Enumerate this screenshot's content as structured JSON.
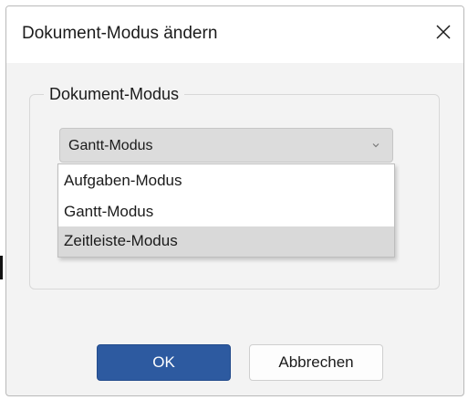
{
  "dialog": {
    "title": "Dokument-Modus ändern",
    "close_icon": "close-icon"
  },
  "group": {
    "legend": "Dokument-Modus",
    "combo": {
      "value": "Gantt-Modus",
      "arrow_icon": "chevron-down-icon"
    },
    "dropdown": {
      "items": [
        {
          "label": "Aufgaben-Modus",
          "highlighted": false
        },
        {
          "label": "Gantt-Modus",
          "highlighted": false
        },
        {
          "label": "Zeitleiste-Modus",
          "highlighted": true
        }
      ]
    }
  },
  "buttons": {
    "ok": "OK",
    "cancel": "Abbrechen"
  },
  "colors": {
    "primary_button": "#2d5aa0",
    "dialog_background": "#f3f3f3",
    "highlight": "#d9d9d9"
  }
}
